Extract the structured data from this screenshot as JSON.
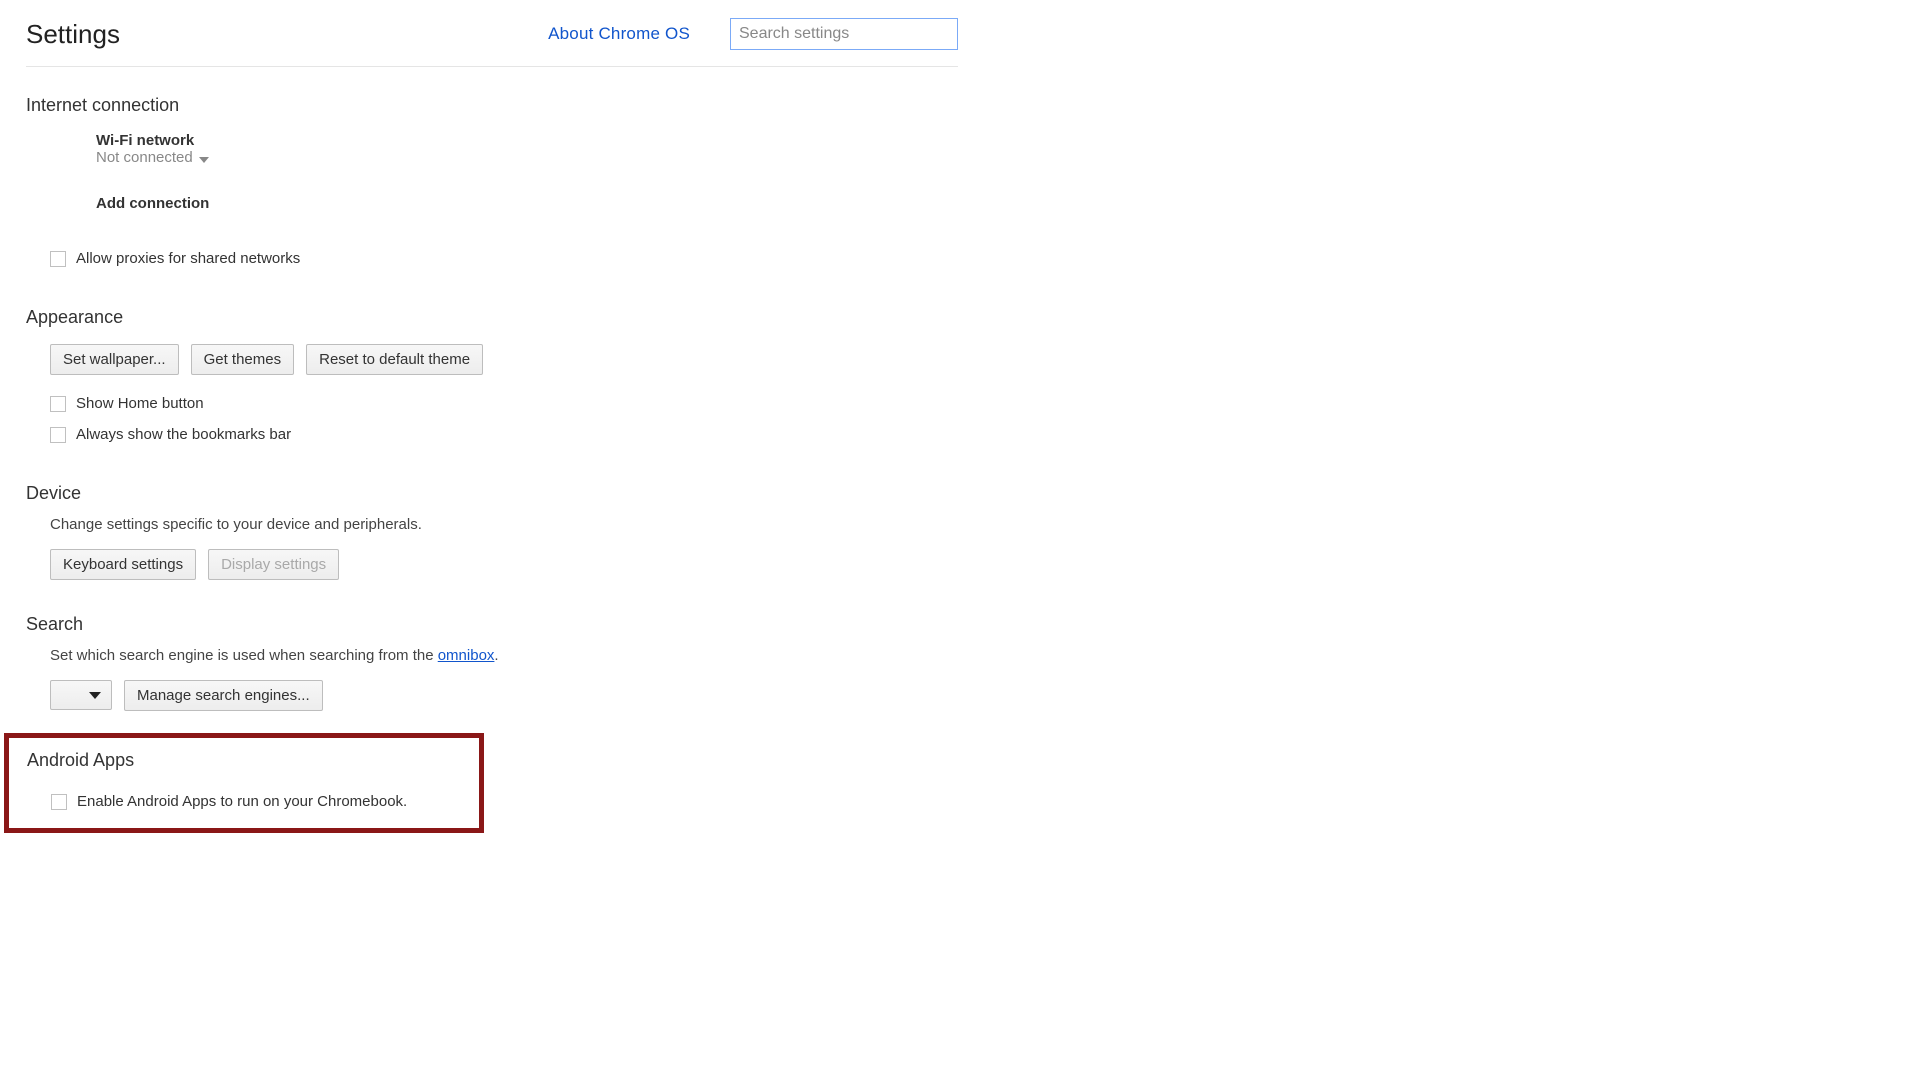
{
  "header": {
    "title": "Settings",
    "about_link": "About Chrome OS",
    "search_placeholder": "Search settings"
  },
  "internet": {
    "title": "Internet connection",
    "wifi_label": "Wi-Fi network",
    "wifi_status": "Not connected",
    "add_connection": "Add connection",
    "allow_proxies": "Allow proxies for shared networks"
  },
  "appearance": {
    "title": "Appearance",
    "set_wallpaper": "Set wallpaper...",
    "get_themes": "Get themes",
    "reset_theme": "Reset to default theme",
    "show_home": "Show Home button",
    "always_bookmarks": "Always show the bookmarks bar"
  },
  "device": {
    "title": "Device",
    "desc": "Change settings specific to your device and peripherals.",
    "keyboard": "Keyboard settings",
    "display": "Display settings"
  },
  "search": {
    "title": "Search",
    "desc_pre": "Set which search engine is used when searching from the ",
    "omnibox": "omnibox",
    "desc_post": ".",
    "manage": "Manage search engines..."
  },
  "android": {
    "title": "Android Apps",
    "enable": "Enable Android Apps to run on your Chromebook."
  }
}
